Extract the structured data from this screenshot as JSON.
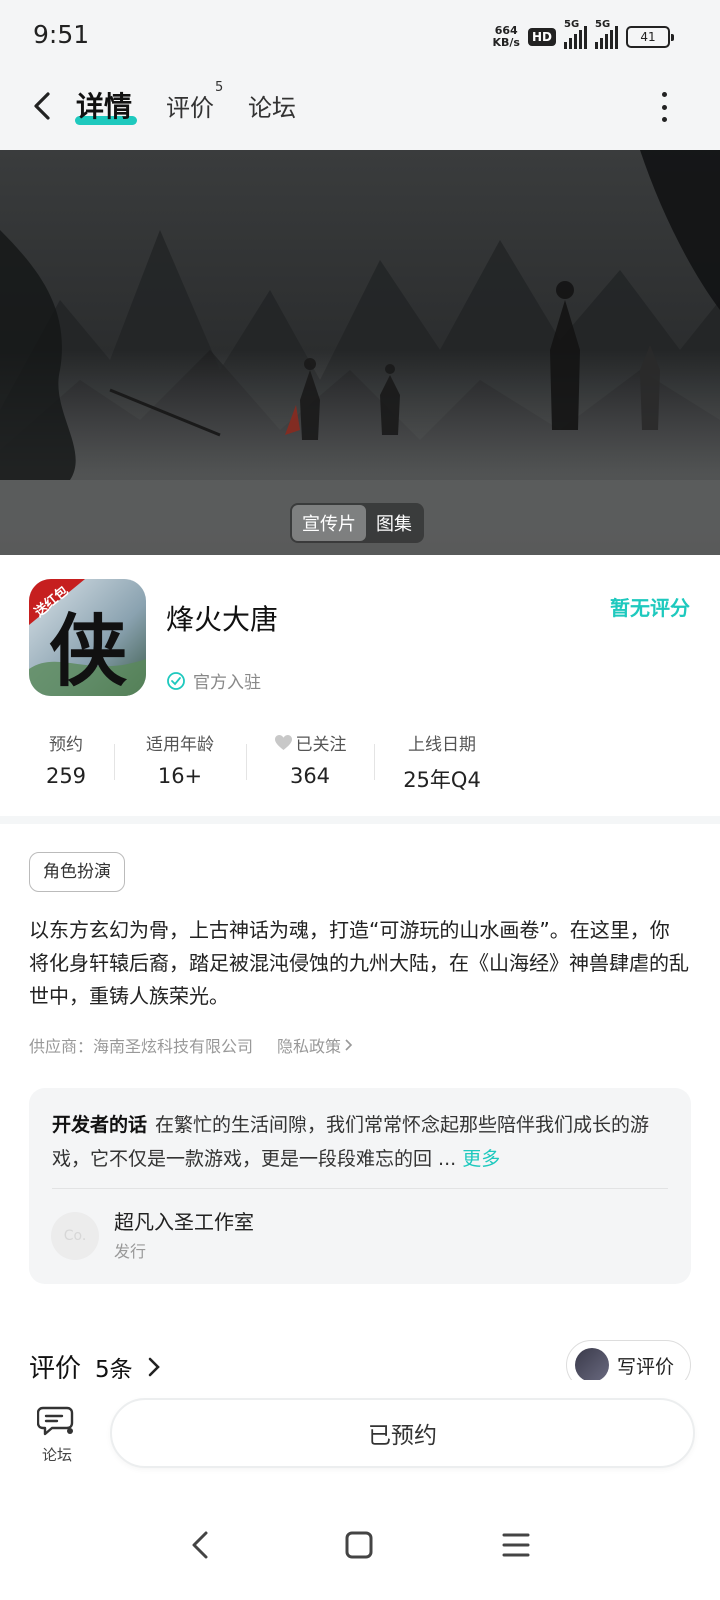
{
  "status_bar": {
    "time": "9:51",
    "net_speed_value": "664",
    "net_speed_unit": "KB/s",
    "hd": "HD",
    "sim1": "5G",
    "sim2": "5G",
    "battery": "41"
  },
  "nav": {
    "tabs": [
      {
        "label": "详情"
      },
      {
        "label": "评价"
      },
      {
        "label": "论坛"
      }
    ],
    "review_badge": "5"
  },
  "banner": {
    "toggle": [
      "宣传片",
      "图集"
    ]
  },
  "app": {
    "icon_text": "侠",
    "icon_ribbon": "送红包",
    "name": "烽火大唐",
    "official": "官方入驻",
    "rating": "暂无评分"
  },
  "stats": [
    {
      "label": "预约",
      "value": "259"
    },
    {
      "label": "适用年龄",
      "value": "16+"
    },
    {
      "label": "已关注",
      "value": "364"
    },
    {
      "label": "上线日期",
      "value": "25年Q4"
    }
  ],
  "genre": "角色扮演",
  "description": "以东方玄幻为骨，上古神话为魂，打造“可游玩的山水画卷”。在这里，你将化身轩辕后裔，踏足被混沌侵蚀的九州大陆，在《山海经》神兽肆虐的乱世中，重铸人族荣光。",
  "supplier": {
    "text": "供应商：海南圣炫科技有限公司",
    "privacy": "隐私政策"
  },
  "developer": {
    "heading": "开发者的话",
    "text": "在繁忙的生活间隙，我们常常怀念起那些陪伴我们成长的游戏，它不仅是一款游戏，更是一段段难忘的回 ...",
    "more": "更多",
    "avatar_text": "Co.",
    "name": "超凡入圣工作室",
    "role": "发行"
  },
  "reviews": {
    "title": "评价",
    "count": "5条",
    "write": "写评价"
  },
  "bottom": {
    "forum": "论坛",
    "reserved": "已预约"
  },
  "colors": {
    "accent": "#1ec9be",
    "page_bg": "#ffffff",
    "bar_bg": "#f4f5f6"
  }
}
